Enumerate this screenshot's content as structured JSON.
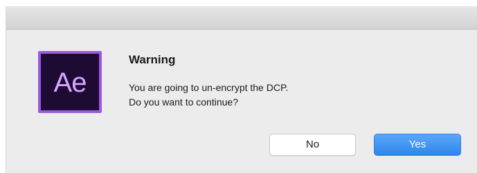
{
  "dialog": {
    "app_icon": {
      "text": "Ae",
      "name": "after-effects-icon",
      "background_color": "#1d0b33",
      "border_color": "#9b59e0",
      "text_color": "#d7a6ff"
    },
    "title": "Warning",
    "message_line1": "You are going to un-encrypt the DCP.",
    "message_line2": "Do you want to continue?",
    "buttons": {
      "no_label": "No",
      "yes_label": "Yes"
    },
    "accent_color": "#2e86ec"
  }
}
